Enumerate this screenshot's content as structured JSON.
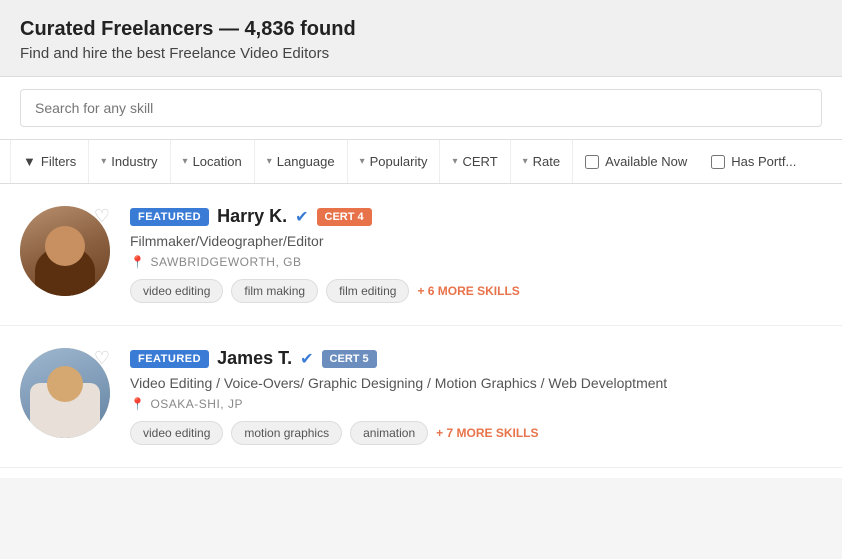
{
  "header": {
    "title": "Curated Freelancers — 4,836 found",
    "subtitle": "Find and hire the best Freelance Video Editors"
  },
  "search": {
    "placeholder": "Search for any skill"
  },
  "filters": {
    "filters_label": "Filters",
    "items": [
      {
        "id": "industry",
        "label": "Industry",
        "hasChevron": true
      },
      {
        "id": "location",
        "label": "Location",
        "hasChevron": true
      },
      {
        "id": "language",
        "label": "Language",
        "hasChevron": true
      },
      {
        "id": "popularity",
        "label": "Popularity",
        "hasChevron": true
      },
      {
        "id": "cert",
        "label": "CERT",
        "hasChevron": true
      },
      {
        "id": "rate",
        "label": "Rate",
        "hasChevron": true
      }
    ],
    "checkboxes": [
      {
        "id": "available-now",
        "label": "Available Now"
      },
      {
        "id": "has-portfolio",
        "label": "Has Portf..."
      }
    ]
  },
  "freelancers": [
    {
      "id": "harry-k",
      "featured_label": "FEATURED",
      "name": "Harry K.",
      "cert": "CERT 4",
      "title": "Filmmaker/Videographer/Editor",
      "location": "SAWBRIDGEWORTH, GB",
      "skills": [
        "video editing",
        "film making",
        "film editing"
      ],
      "more_skills": "+ 6 MORE SKILLS",
      "avatar_type": "harry"
    },
    {
      "id": "james-t",
      "featured_label": "FEATURED",
      "name": "James T.",
      "cert": "CERT 5",
      "title": "Video Editing / Voice-Overs/ Graphic Designing / Motion Graphics / Web Developtment",
      "location": "OSAKA-SHI, JP",
      "skills": [
        "video editing",
        "motion graphics",
        "animation"
      ],
      "more_skills": "+ 7 MORE SKILLS",
      "avatar_type": "james"
    }
  ],
  "icons": {
    "heart": "♡",
    "location_pin": "📍",
    "verified": "✔",
    "chevron_down": "▾",
    "funnel": "⊿"
  }
}
